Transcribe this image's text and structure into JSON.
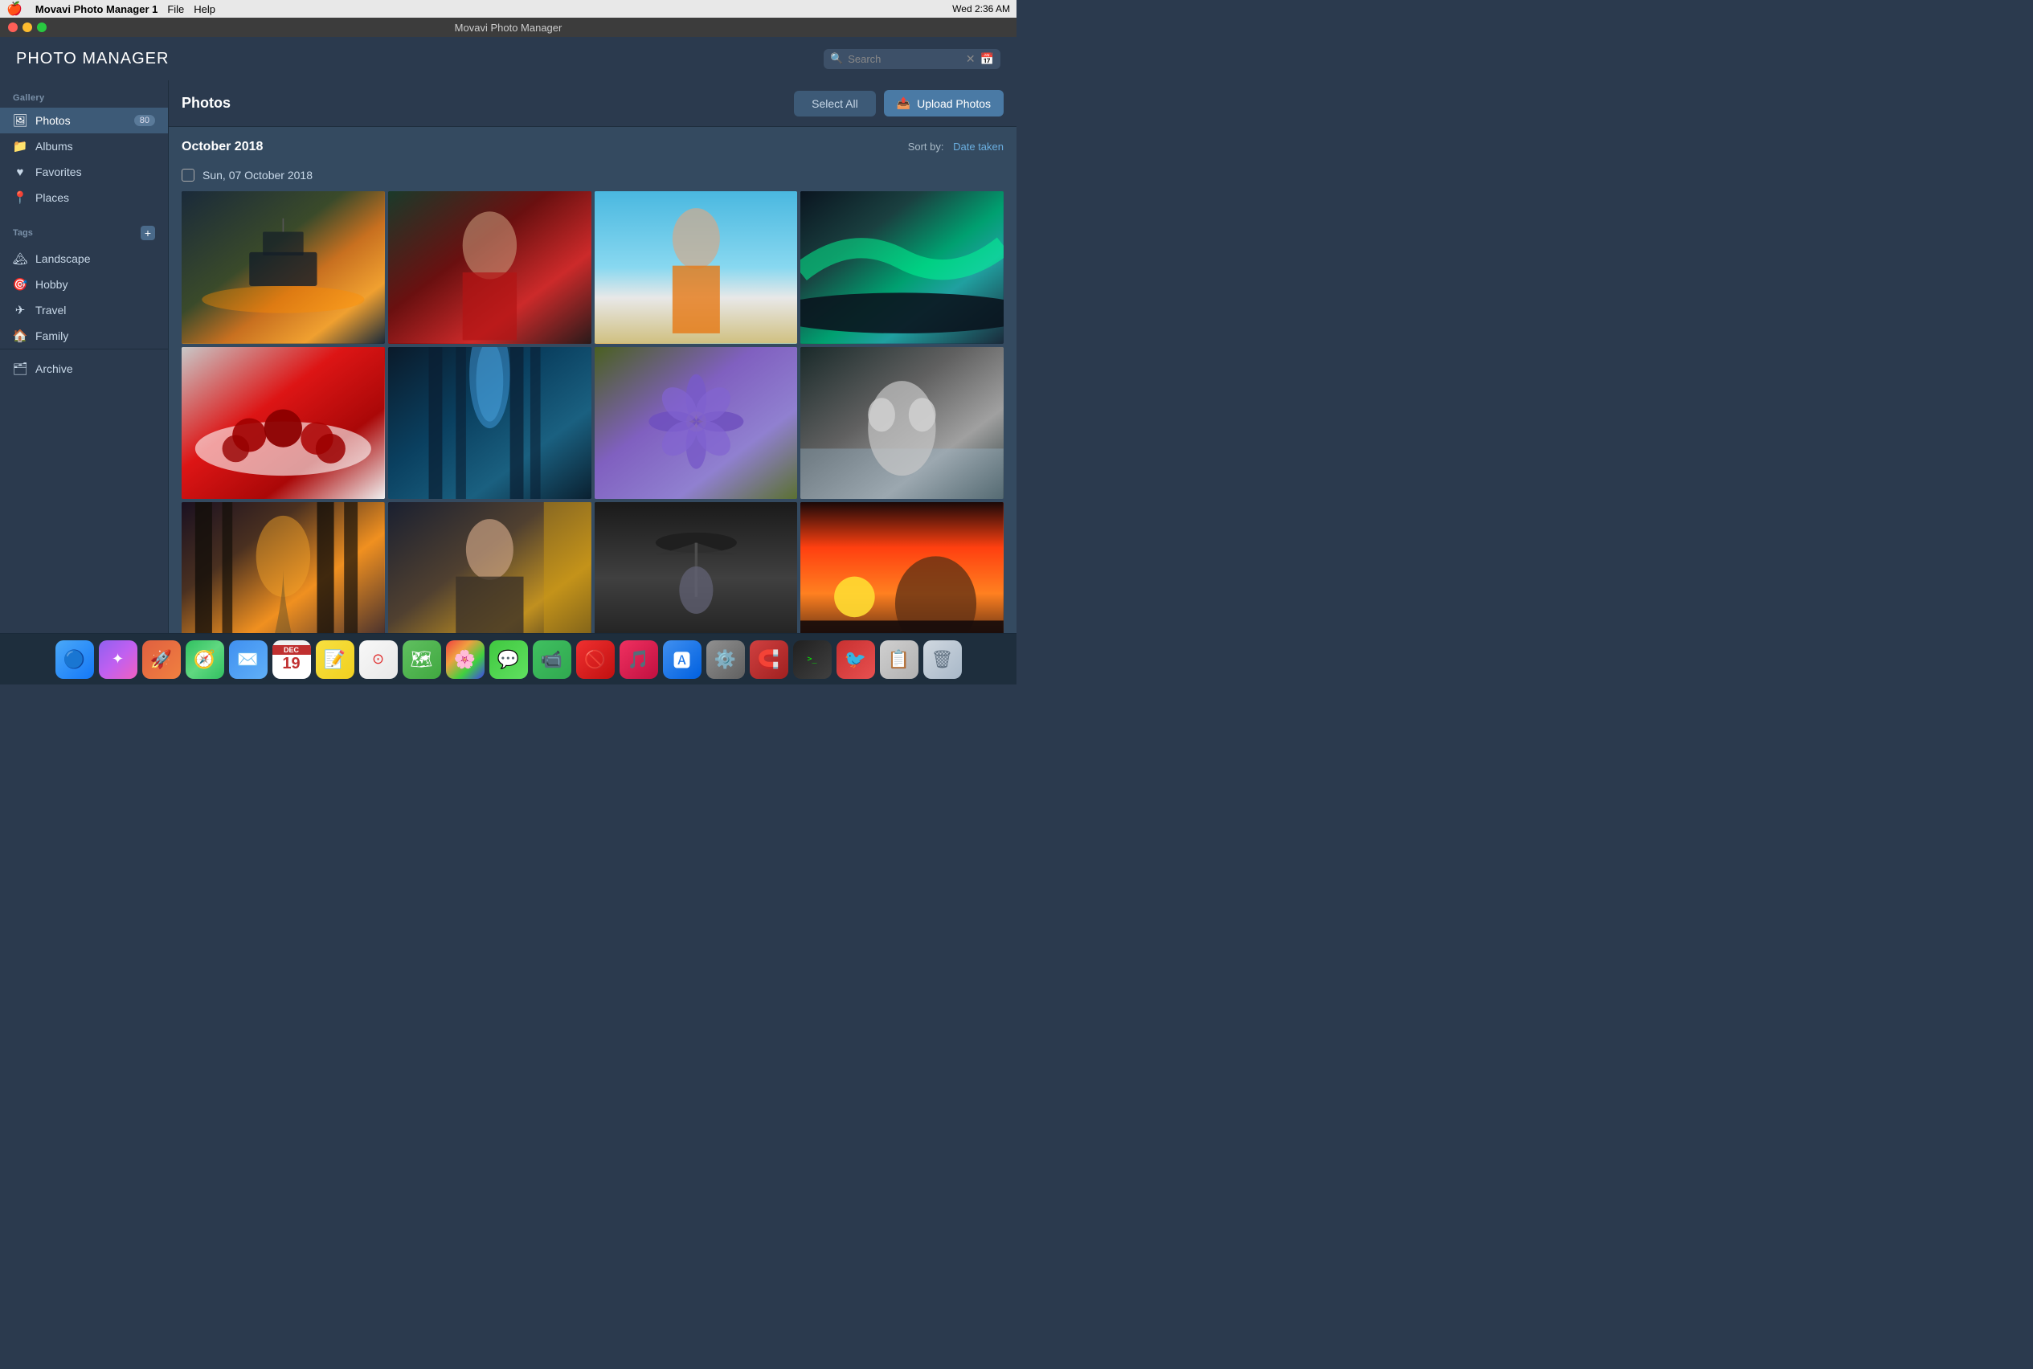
{
  "menubar": {
    "apple": "🍎",
    "app_name": "Movavi Photo Manager 1",
    "menus": [
      "File",
      "Help"
    ],
    "time": "Wed 2:36 AM",
    "title": "Movavi Photo Manager"
  },
  "app_header": {
    "logo_bold": "PHOTO",
    "logo_light": " MANAGER",
    "search_placeholder": "Search"
  },
  "sidebar": {
    "gallery_label": "Gallery",
    "items": [
      {
        "id": "photos",
        "label": "Photos",
        "badge": "80",
        "active": true
      },
      {
        "id": "albums",
        "label": "Albums",
        "badge": ""
      },
      {
        "id": "favorites",
        "label": "Favorites",
        "badge": ""
      },
      {
        "id": "places",
        "label": "Places",
        "badge": ""
      }
    ],
    "tags_label": "Tags",
    "tags_add": "+",
    "tag_items": [
      {
        "id": "landscape",
        "label": "Landscape"
      },
      {
        "id": "hobby",
        "label": "Hobby"
      },
      {
        "id": "travel",
        "label": "Travel"
      },
      {
        "id": "family",
        "label": "Family"
      }
    ],
    "archive_label": "Archive"
  },
  "photo_area": {
    "title": "Photos",
    "select_all_label": "Select All",
    "upload_label": "Upload Photos",
    "sort_prefix": "Sort by:",
    "sort_value": "Date taken",
    "month_label": "October 2018",
    "date_label": "Sun, 07 October 2018"
  },
  "dock": {
    "items": [
      {
        "id": "finder",
        "label": "Finder"
      },
      {
        "id": "siri",
        "label": "Siri"
      },
      {
        "id": "launchpad",
        "label": "Launchpad"
      },
      {
        "id": "safari",
        "label": "Safari"
      },
      {
        "id": "mail",
        "label": "Mail"
      },
      {
        "id": "calendar",
        "label": "Calendar",
        "month": "DEC",
        "day": "19"
      },
      {
        "id": "notes",
        "label": "Notes"
      },
      {
        "id": "reminders",
        "label": "Reminders"
      },
      {
        "id": "maps",
        "label": "Maps"
      },
      {
        "id": "photos",
        "label": "Photos"
      },
      {
        "id": "messages",
        "label": "Messages"
      },
      {
        "id": "facetime",
        "label": "FaceTime"
      },
      {
        "id": "news",
        "label": "News"
      },
      {
        "id": "music",
        "label": "Music"
      },
      {
        "id": "appstore",
        "label": "App Store"
      },
      {
        "id": "settings",
        "label": "System Preferences"
      },
      {
        "id": "magnet",
        "label": "Magnet"
      },
      {
        "id": "terminal",
        "label": "Terminal"
      },
      {
        "id": "airmail",
        "label": "Airmail"
      },
      {
        "id": "clipboard",
        "label": "Clipboard"
      },
      {
        "id": "trash",
        "label": "Trash"
      }
    ]
  }
}
